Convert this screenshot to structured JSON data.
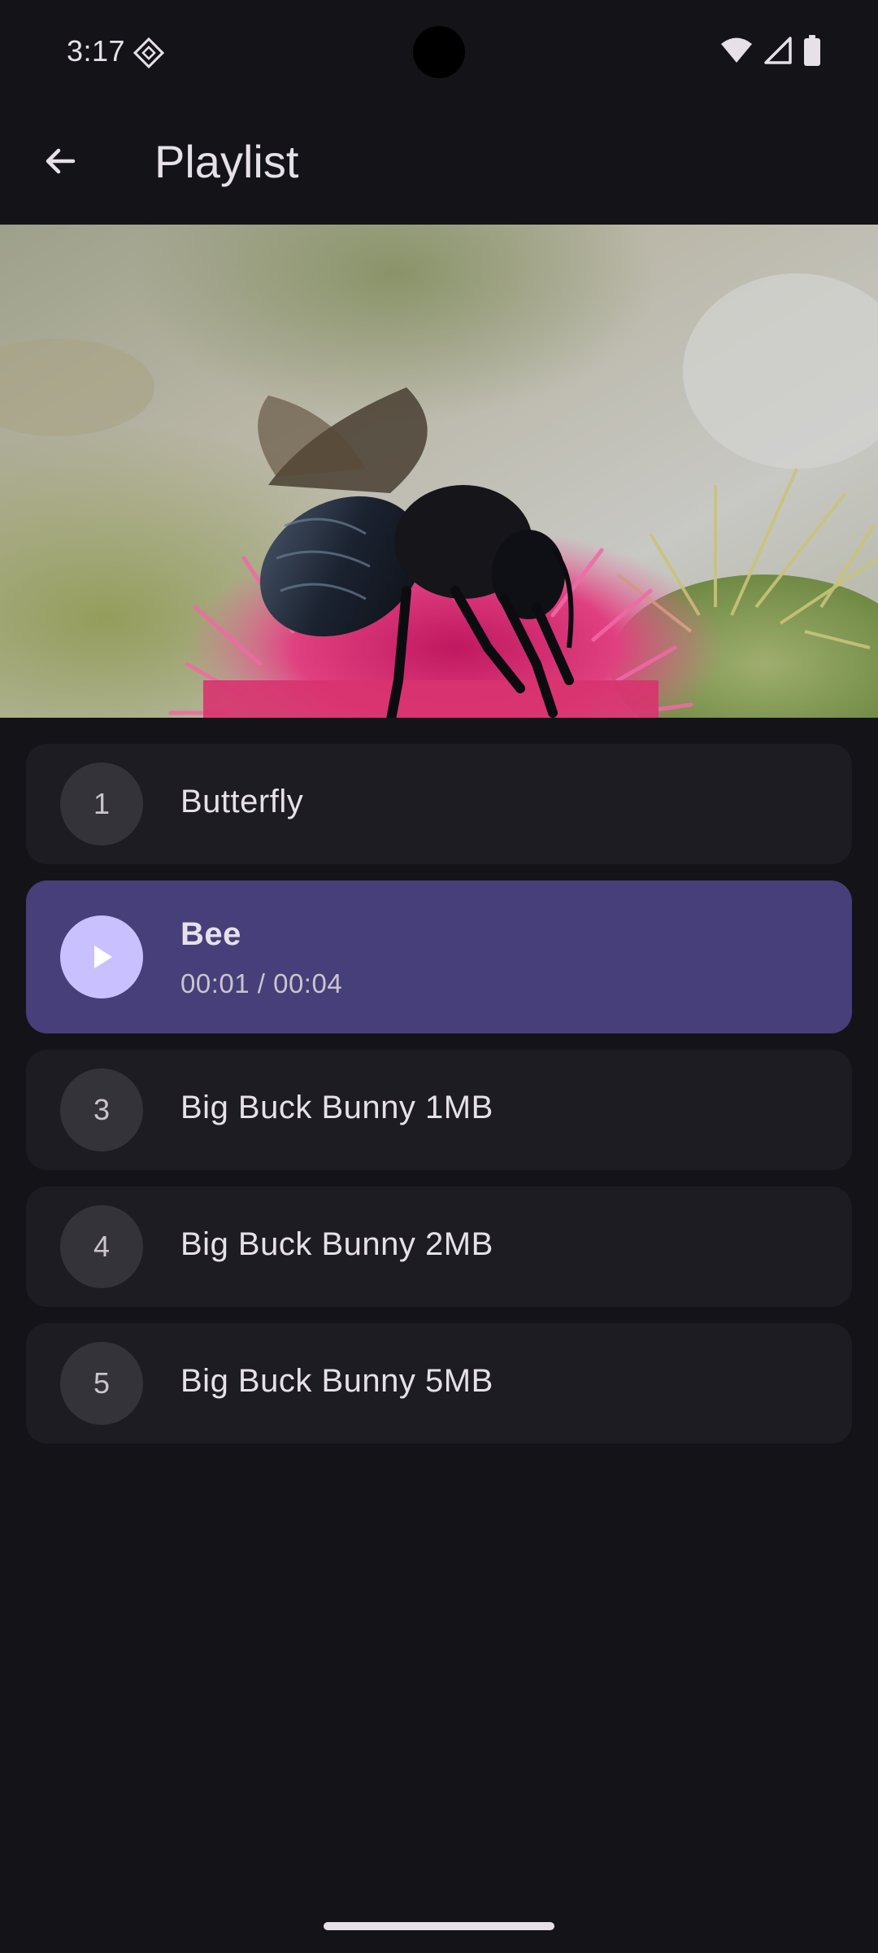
{
  "status_bar": {
    "time": "3:17",
    "icons": [
      "diamond-badge-icon",
      "wifi-icon",
      "cell-signal-icon",
      "battery-icon"
    ]
  },
  "app_bar": {
    "back_icon": "arrow-back-icon",
    "title": "Playlist"
  },
  "video": {
    "subject": "bee-on-thistle-frame"
  },
  "playlist": {
    "items": [
      {
        "index": "1",
        "title": "Butterfly",
        "active": false
      },
      {
        "index": "2",
        "title": "Bee",
        "progress": "00:01 / 00:04",
        "active": true,
        "icon": "play-icon"
      },
      {
        "index": "3",
        "title": "Big Buck Bunny 1MB",
        "active": false
      },
      {
        "index": "4",
        "title": "Big Buck Bunny 2MB",
        "active": false
      },
      {
        "index": "5",
        "title": "Big Buck Bunny 5MB",
        "active": false
      }
    ]
  },
  "colors": {
    "background": "#141318",
    "card": "#1d1c22",
    "active_card": "#463f79",
    "active_circle": "#c9c1ff"
  }
}
